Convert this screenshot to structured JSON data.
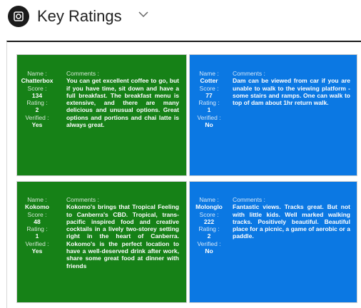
{
  "header": {
    "title": "Key Ratings"
  },
  "labels": {
    "name": "Name :",
    "score": "Score :",
    "rating": "Rating :",
    "verified": "Verified :",
    "comments": "Comments :"
  },
  "cards": [
    {
      "name": "Chatterbox",
      "score": "134",
      "rating": "2",
      "verified": "Yes",
      "comments": "You can get excellent coffee to go, but if you have time, sit down and have a full breakfast. The breakfast menu is extensive, and there are many delicious and unusual options. Great options and portions and chai latte is always great.",
      "color": "#168117"
    },
    {
      "name": "Cotter",
      "score": "77",
      "rating": "1",
      "verified": "No",
      "comments": "Dam can be viewed from car if you are unable to walk to the viewing platform - some stairs and ramps. One can walk to top of dam about 1hr return walk.",
      "color": "#0b78e3"
    },
    {
      "name": "Kokomo",
      "score": "48",
      "rating": "1",
      "verified": "Yes",
      "comments": "Kokomo's brings that Tropical Feeling to Canberra's CBD. Tropical, trans-pacific inspired food and creative cocktails in a lively two-storey setting right in the heart of Canberra. Kokomo's is the perfect location to have a well-deserved drink after work, share some great food at dinner with friends",
      "color": "#168117"
    },
    {
      "name": "Molonglo",
      "score": "222",
      "rating": "2",
      "verified": "No",
      "comments": "Fantastic views. Tracks great. But not with little kids. Well marked walking tracks. Positively beautiful. Beautiful place for a picnic, a game of aerobic or a paddle.",
      "color": "#0b78e3"
    }
  ]
}
